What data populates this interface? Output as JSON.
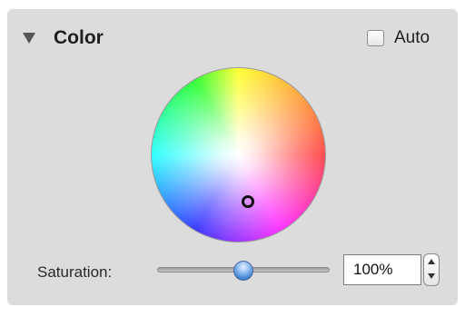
{
  "panel": {
    "title": "Color",
    "disclosure_icon": "disclosure-triangle-down-icon",
    "auto_checkbox": {
      "label": "Auto",
      "checked": false
    },
    "color_wheel": {
      "marker": "color-marker"
    },
    "saturation": {
      "label": "Saturation:",
      "value_text": "100%",
      "slider_level": 0.5
    },
    "stepper_icons": [
      "chevron-up-icon",
      "chevron-down-icon"
    ],
    "colors": {
      "panel_bg": "#dcdcdc",
      "knob": "#3f7fd2",
      "text": "#1f1f1f"
    }
  }
}
